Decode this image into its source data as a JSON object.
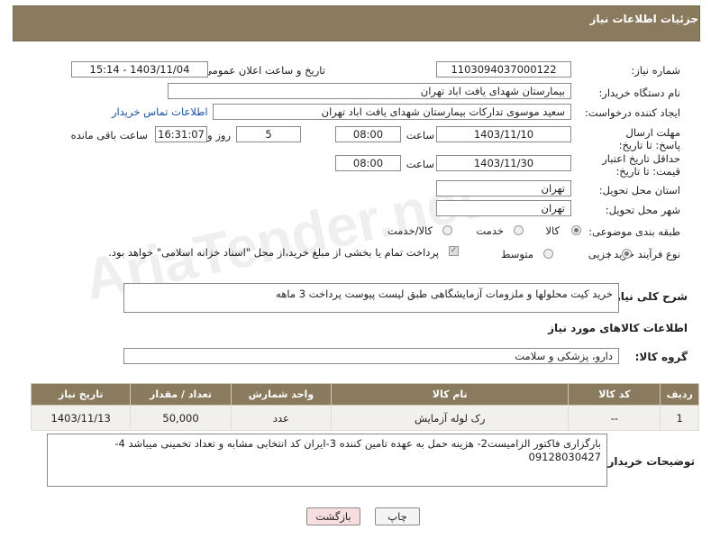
{
  "header": {
    "title": "جزئیات اطلاعات نیاز"
  },
  "fields": {
    "need_number_label": "شماره نیاز:",
    "need_number": "1103094037000122",
    "announce_label": "تاریخ و ساعت اعلان عمومی:",
    "announce_value": "1403/11/04 - 15:14",
    "buyer_org_label": "نام دستگاه خریدار:",
    "buyer_org": "بیمارستان شهدای یافت اباد تهران",
    "requester_label": "ایجاد کننده درخواست:",
    "requester": "سعید موسوی تدارکات بیمارستان شهدای یافت اباد تهران",
    "contact_link": "اطلاعات تماس خریدار",
    "deadline_label": "مهلت ارسال پاسخ: تا تاریخ:",
    "deadline_date": "1403/11/10",
    "time_label": "ساعت",
    "deadline_time": "08:00",
    "days_value": "5",
    "days_label": "روز و",
    "remaining_time": "16:31:07",
    "remaining_label": "ساعت باقی مانده",
    "validity_label": "حداقل تاریخ اعتبار قیمت: تا تاریخ:",
    "validity_date": "1403/11/30",
    "validity_time": "08:00",
    "province_label": "استان محل تحویل:",
    "province": "تهران",
    "city_label": "شهر محل تحویل:",
    "city": "تهران",
    "category_label": "طبقه بندی موضوعی:",
    "category_options": [
      "کالا",
      "خدمت",
      "کالا/خدمت"
    ],
    "process_label": "نوع فرآیند خرید :",
    "process_options": [
      "جزیی",
      "متوسط"
    ],
    "payment_note": "پرداخت تمام یا بخشی از مبلغ خرید،از محل \"اسناد خزانه اسلامی\" خواهد بود."
  },
  "description": {
    "label": "شرح کلی نیاز:",
    "text": "خرید  کیت  محلولها و ملزومات آزمایشگاهی طبق لیست پیوست پرداخت 3 ماهه"
  },
  "goods": {
    "section_title": "اطلاعات کالاهای مورد نیاز",
    "group_label": "گروه کالا:",
    "group_value": "دارو، پزشکی و سلامت",
    "columns": [
      "ردیف",
      "کد کالا",
      "نام کالا",
      "واحد شمارش",
      "تعداد / مقدار",
      "تاریخ نیاز"
    ],
    "rows": [
      [
        "1",
        "--",
        "رک لوله آزمایش",
        "عدد",
        "50,000",
        "1403/11/13"
      ]
    ]
  },
  "buyer_notes": {
    "label": "توضیحات خریدار:",
    "text": "بارگزاری فاکتور الزامیست2- هزینه حمل به عهده تامین کننده 3-ایران کد انتخابی مشابه و تعداد تخمینی میباشد 4-09128030427"
  },
  "buttons": {
    "print": "چاپ",
    "back": "بازگشت"
  },
  "watermark": "AriaTender.net",
  "colors": {
    "header_bg": "#8b7b5e",
    "link": "#1a4fa0",
    "back_button_bg": "#f8dede"
  }
}
